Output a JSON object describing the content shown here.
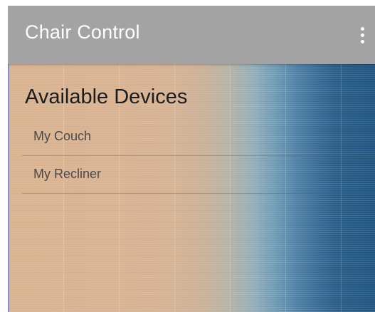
{
  "toolbar": {
    "title": "Chair Control",
    "menu_icon": "more-vert-icon"
  },
  "main": {
    "section_title": "Available Devices",
    "devices": [
      {
        "label": "My Couch"
      },
      {
        "label": "My Recliner"
      }
    ]
  },
  "colors": {
    "toolbar_background": "#a3a3a3",
    "toolbar_text": "#ffffff",
    "heading_text": "#1c1c1c",
    "item_text": "#4a4a4a"
  }
}
